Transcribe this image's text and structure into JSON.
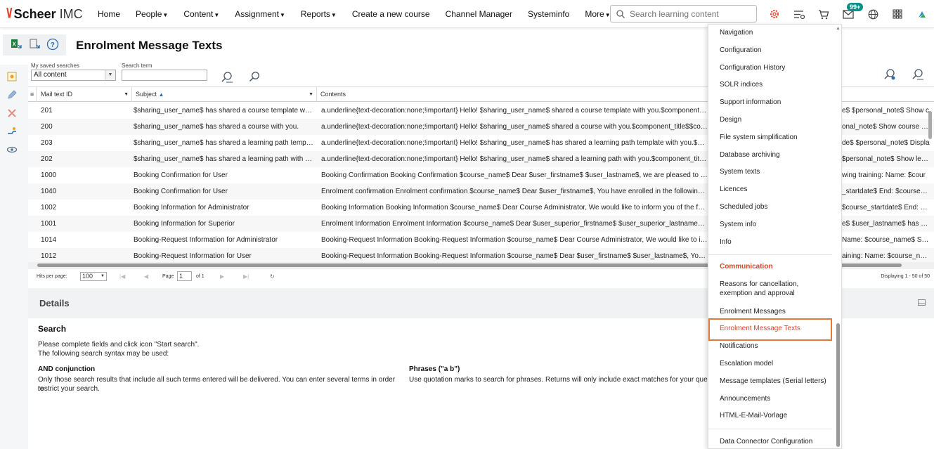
{
  "app": {
    "logo_mark": "\\/",
    "brand": "Scheer",
    "product": "IMC"
  },
  "nav": {
    "items": [
      {
        "label": "Home",
        "dropdown": false
      },
      {
        "label": "People",
        "dropdown": true
      },
      {
        "label": "Content",
        "dropdown": true
      },
      {
        "label": "Assignment",
        "dropdown": true
      },
      {
        "label": "Reports",
        "dropdown": true
      },
      {
        "label": "Create a new course",
        "dropdown": false
      },
      {
        "label": "Channel Manager",
        "dropdown": false
      },
      {
        "label": "Systeminfo",
        "dropdown": false
      },
      {
        "label": "More",
        "dropdown": true
      }
    ],
    "search_placeholder": "Search learning content",
    "notification_badge": "99+",
    "accent_color": "#e8412c"
  },
  "page": {
    "title": "Enrolment Message Texts"
  },
  "filters": {
    "saved_searches_label": "My saved searches",
    "saved_searches_value": "All content",
    "search_term_label": "Search term",
    "search_term_value": ""
  },
  "grid": {
    "columns": [
      "Mail text ID",
      "Subject",
      "Contents"
    ],
    "sort_column": "Subject",
    "rows": [
      {
        "id": "201",
        "subject": "$sharing_user_name$ has shared a course template with...",
        "contents": "a.underline{text-decoration:none;!important} Hello! $sharing_user_name$ shared a course template with you.$component_title$",
        "tail": "e$ $personal_note$ Show c"
      },
      {
        "id": "200",
        "subject": "$sharing_user_name$ has shared a course with you.",
        "contents": "a.underline{text-decoration:none;!important} Hello! $sharing_user_name$ shared a course with you.$component_title$$compon",
        "tail": "onal_note$ Show course in F"
      },
      {
        "id": "203",
        "subject": "$sharing_user_name$ has shared a learning path templat...",
        "contents": "a.underline{text-decoration:none;!important} Hello! $sharing_user_name$ has shared a learning path template with you.$component_title",
        "tail": "de$ $personal_note$ Displa"
      },
      {
        "id": "202",
        "subject": "$sharing_user_name$ has shared a learning path with you.",
        "contents": "a.underline{text-decoration:none;!important} Hello! $sharing_user_name$ shared a learning path with you.$component_title$$c",
        "tail": "$personal_note$ Show learr"
      },
      {
        "id": "1000",
        "subject": "Booking Confirmation for User",
        "contents": "Booking Confirmation  Booking Confirmation $course_name$ Dear $user_firstname$ $user_lastname$, we are pleased to confir",
        "tail": "wing training:  Name: $cour"
      },
      {
        "id": "1040",
        "subject": "Booking Confirmation for User",
        "contents": "Enrolment confirmation  Enrolment confirmation $course_name$ Dear $user_firstname$, You have enrolled in the following trai",
        "tail": "_startdate$ End: $course_en"
      },
      {
        "id": "1002",
        "subject": "Booking Information for Administrator",
        "contents": "Booking Information  Booking Information $course_name$ Dear Course Administrator, We would like to inform you of the follow",
        "tail": "$course_startdate$ End: $cc"
      },
      {
        "id": "1001",
        "subject": "Booking Information for Superior",
        "contents": "Enrolment Information  Enrolment Information $course_name$ Dear $user_superior_firstname$ $user_superior_lastname$, We",
        "tail": "e$ $user_lastname$ has bee"
      },
      {
        "id": "1014",
        "subject": "Booking-Request Information for Administrator",
        "contents": "Booking-Request Information Booking-Request Information $course_name$ Dear Course Administrator, We would like to inform",
        "tail": "Name: $course_name$ Start"
      },
      {
        "id": "1012",
        "subject": "Booking-Request Information for User",
        "contents": "Booking-Request Information  Booking-Request Information $course_name$ Dear $user_firstname$ $user_lastname$, You have",
        "tail": "aining:  Name: $course_nam"
      }
    ]
  },
  "pager": {
    "hits_label": "Hits per page:",
    "hits_value": "100",
    "page_label": "Page",
    "page_value": "1",
    "of_label": "of 1",
    "displaying": "Displaying 1 - 50 of 50"
  },
  "details": {
    "title": "Details"
  },
  "help": {
    "title": "Search",
    "intro_1": "Please complete fields and click icon \"Start search\".",
    "intro_2": "The following search syntax may be used:",
    "and_title": "AND conjunction",
    "and_text_1": "Only those search results that include all such terms entered will be delivered. You can enter several terms in order to",
    "and_text_2": "restrict your search.",
    "phrase_title": "Phrases (\"a b\")",
    "phrase_text": "Use quotation marks to search for phrases. Returns will only include exact matches for your query"
  },
  "menu": {
    "items_top": [
      "Navigation",
      "Configuration",
      "Configuration History",
      "SOLR indices",
      "Support information",
      "Design",
      "File system simplification",
      "Database archiving",
      "System texts",
      "Licences",
      "Scheduled jobs",
      "System info",
      "Info"
    ],
    "section": "Communication",
    "cancel_1": "Reasons for cancellation,",
    "cancel_2": "exemption and approval",
    "items_comm": [
      "Enrolment Messages",
      "Enrolment Message Texts",
      "Notifications",
      "Escalation model",
      "Message templates (Serial letters)",
      "Announcements",
      "HTML-E-Mail-Vorlage"
    ],
    "active_item": "Enrolment Message Texts",
    "active_color": "#e07a3c",
    "last_item": "Data Connector Configuration"
  }
}
